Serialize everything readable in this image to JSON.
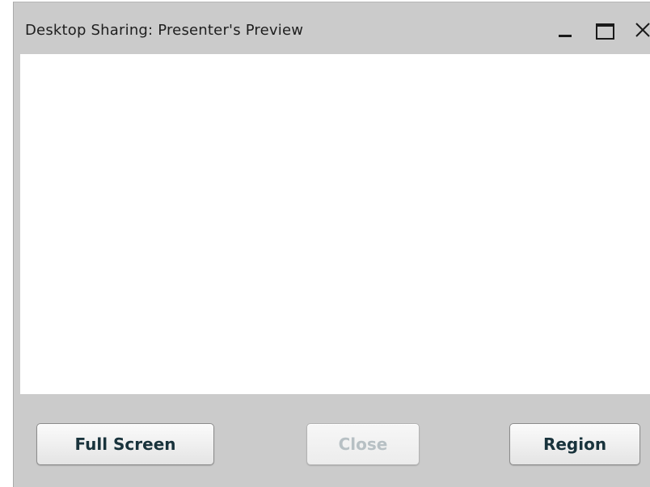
{
  "window": {
    "title": "Desktop Sharing: Presenter's Preview",
    "controls": {
      "minimize": "minimize-icon",
      "maximize": "maximize-icon",
      "close": "close-icon"
    }
  },
  "buttons": {
    "full_screen": "Full Screen",
    "close": "Close",
    "region": "Region"
  },
  "states": {
    "close_enabled": false
  },
  "colors": {
    "window_bg": "#cbcbcb",
    "preview_bg": "#ffffff",
    "button_text": "#19333c",
    "disabled_text": "#b7c0c4"
  }
}
